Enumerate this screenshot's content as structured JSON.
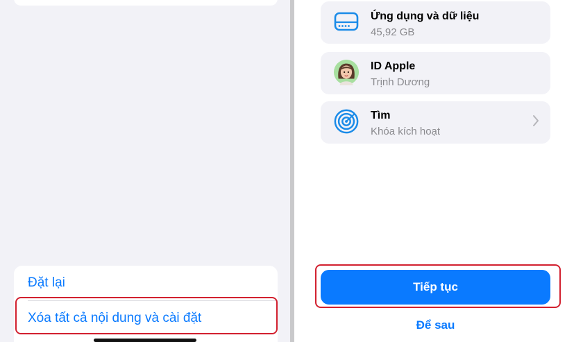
{
  "left_screen": {
    "reset_options": [
      {
        "label": "Đặt lại"
      },
      {
        "label": "Xóa tất cả nội dung và cài đặt"
      }
    ]
  },
  "right_screen": {
    "items": [
      {
        "title": "Ứng dụng và dữ liệu",
        "subtitle": "45,92 GB",
        "icon": "drive-icon"
      },
      {
        "title": "ID Apple",
        "subtitle": "Trịnh Dương",
        "icon": "avatar"
      },
      {
        "title": "Tìm",
        "subtitle": "Khóa kích hoạt",
        "icon": "find-my-icon"
      }
    ],
    "continue_label": "Tiếp tục",
    "later_label": "Để sau"
  },
  "colors": {
    "accent": "#0a7aff",
    "highlight": "#d2202f",
    "find_icon": "#1a8be8"
  }
}
